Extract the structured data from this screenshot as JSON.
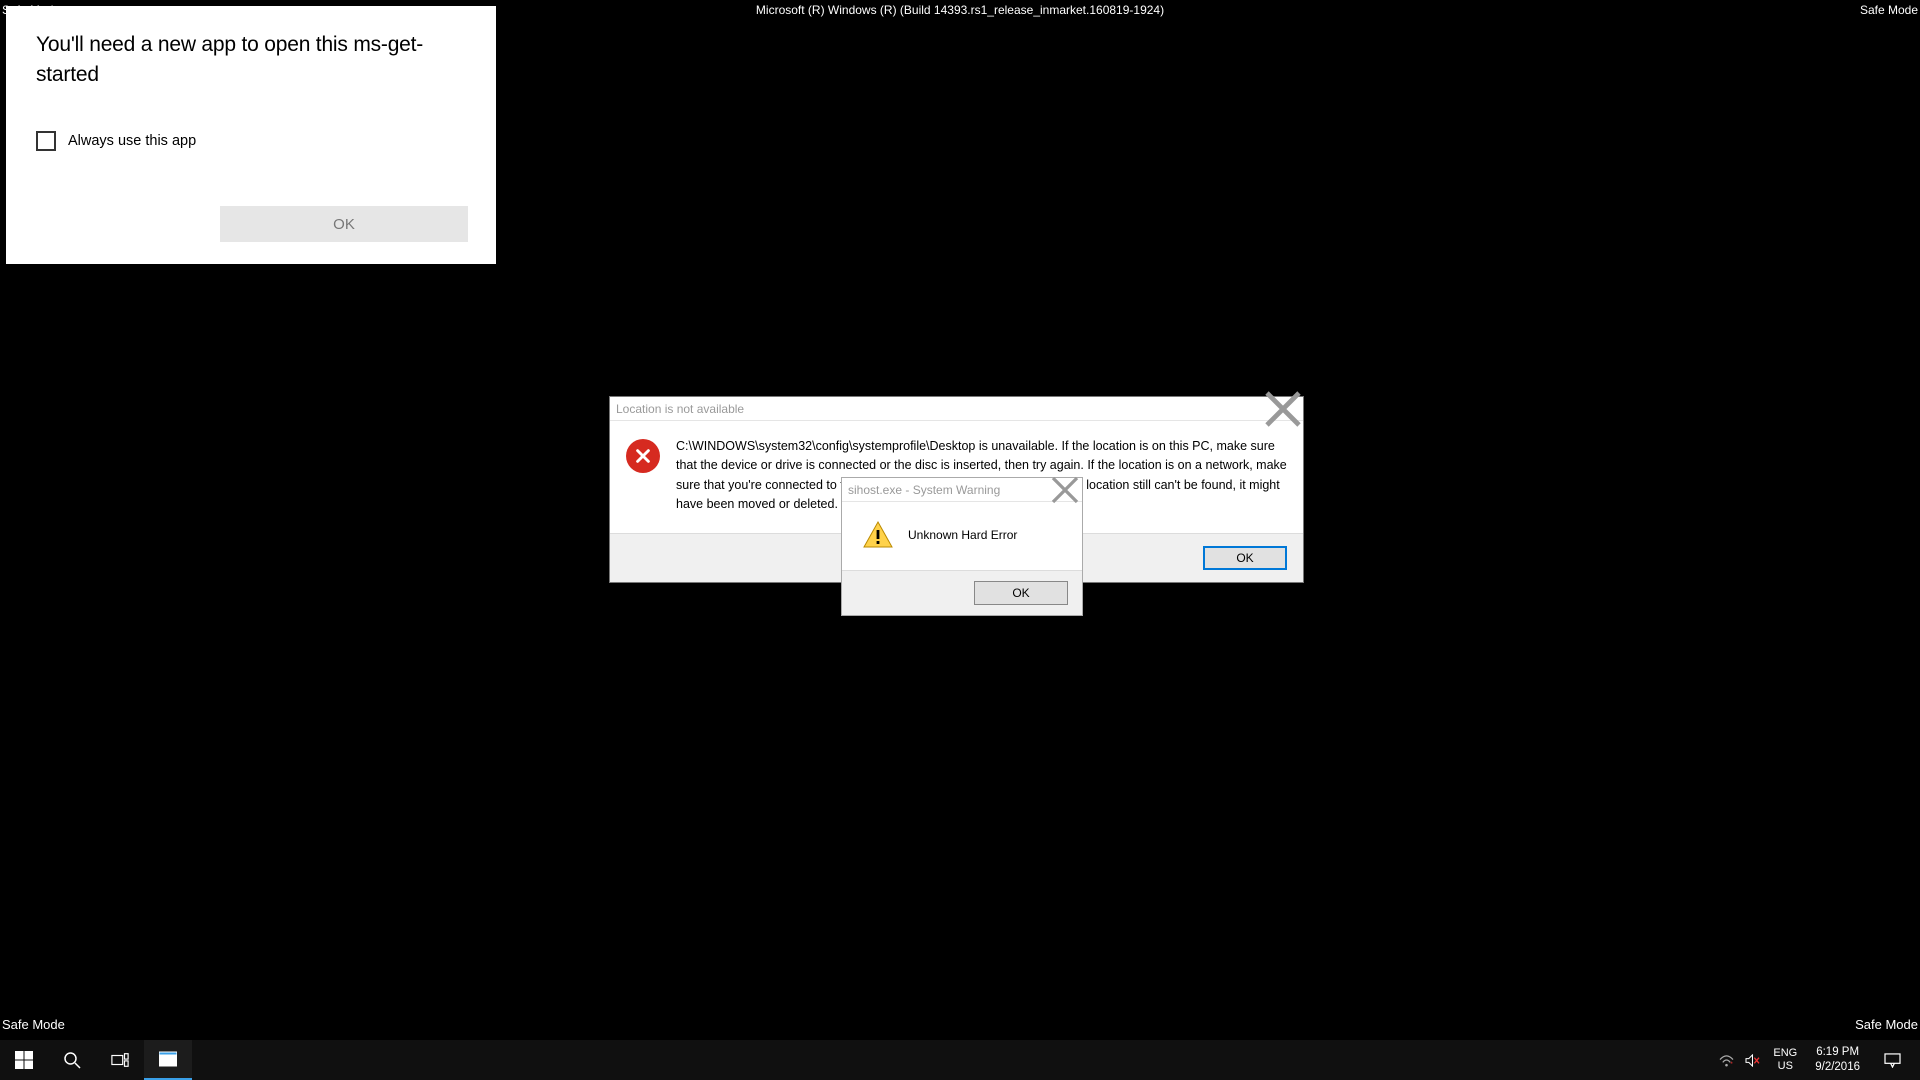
{
  "watermark": {
    "top_left": "Safe Mode",
    "top_center": "Microsoft (R) Windows (R) (Build 14393.rs1_release_inmarket.160819-1924)",
    "top_right": "Safe Mode",
    "bottom_left": "Safe Mode",
    "bottom_right": "Safe Mode"
  },
  "app_picker": {
    "heading": "You'll need a new app to open this ms-get-started",
    "always_label": "Always use this app",
    "ok_label": "OK"
  },
  "location_dialog": {
    "title": "Location is not available",
    "message": "C:\\WINDOWS\\system32\\config\\systemprofile\\Desktop is unavailable. If the location is on this PC, make sure that the device or drive is connected or the disc is inserted, then try again. If the location is on a network, make sure that you're connected to the network or Internet, then try again. If the location still can't be found, it might have been moved or deleted.",
    "ok_label": "OK"
  },
  "sihost_dialog": {
    "title": "sihost.exe - System Warning",
    "message": "Unknown Hard Error",
    "ok_label": "OK"
  },
  "taskbar": {
    "lang_top": "ENG",
    "lang_bottom": "US",
    "time": "6:19 PM",
    "date": "9/2/2016"
  }
}
